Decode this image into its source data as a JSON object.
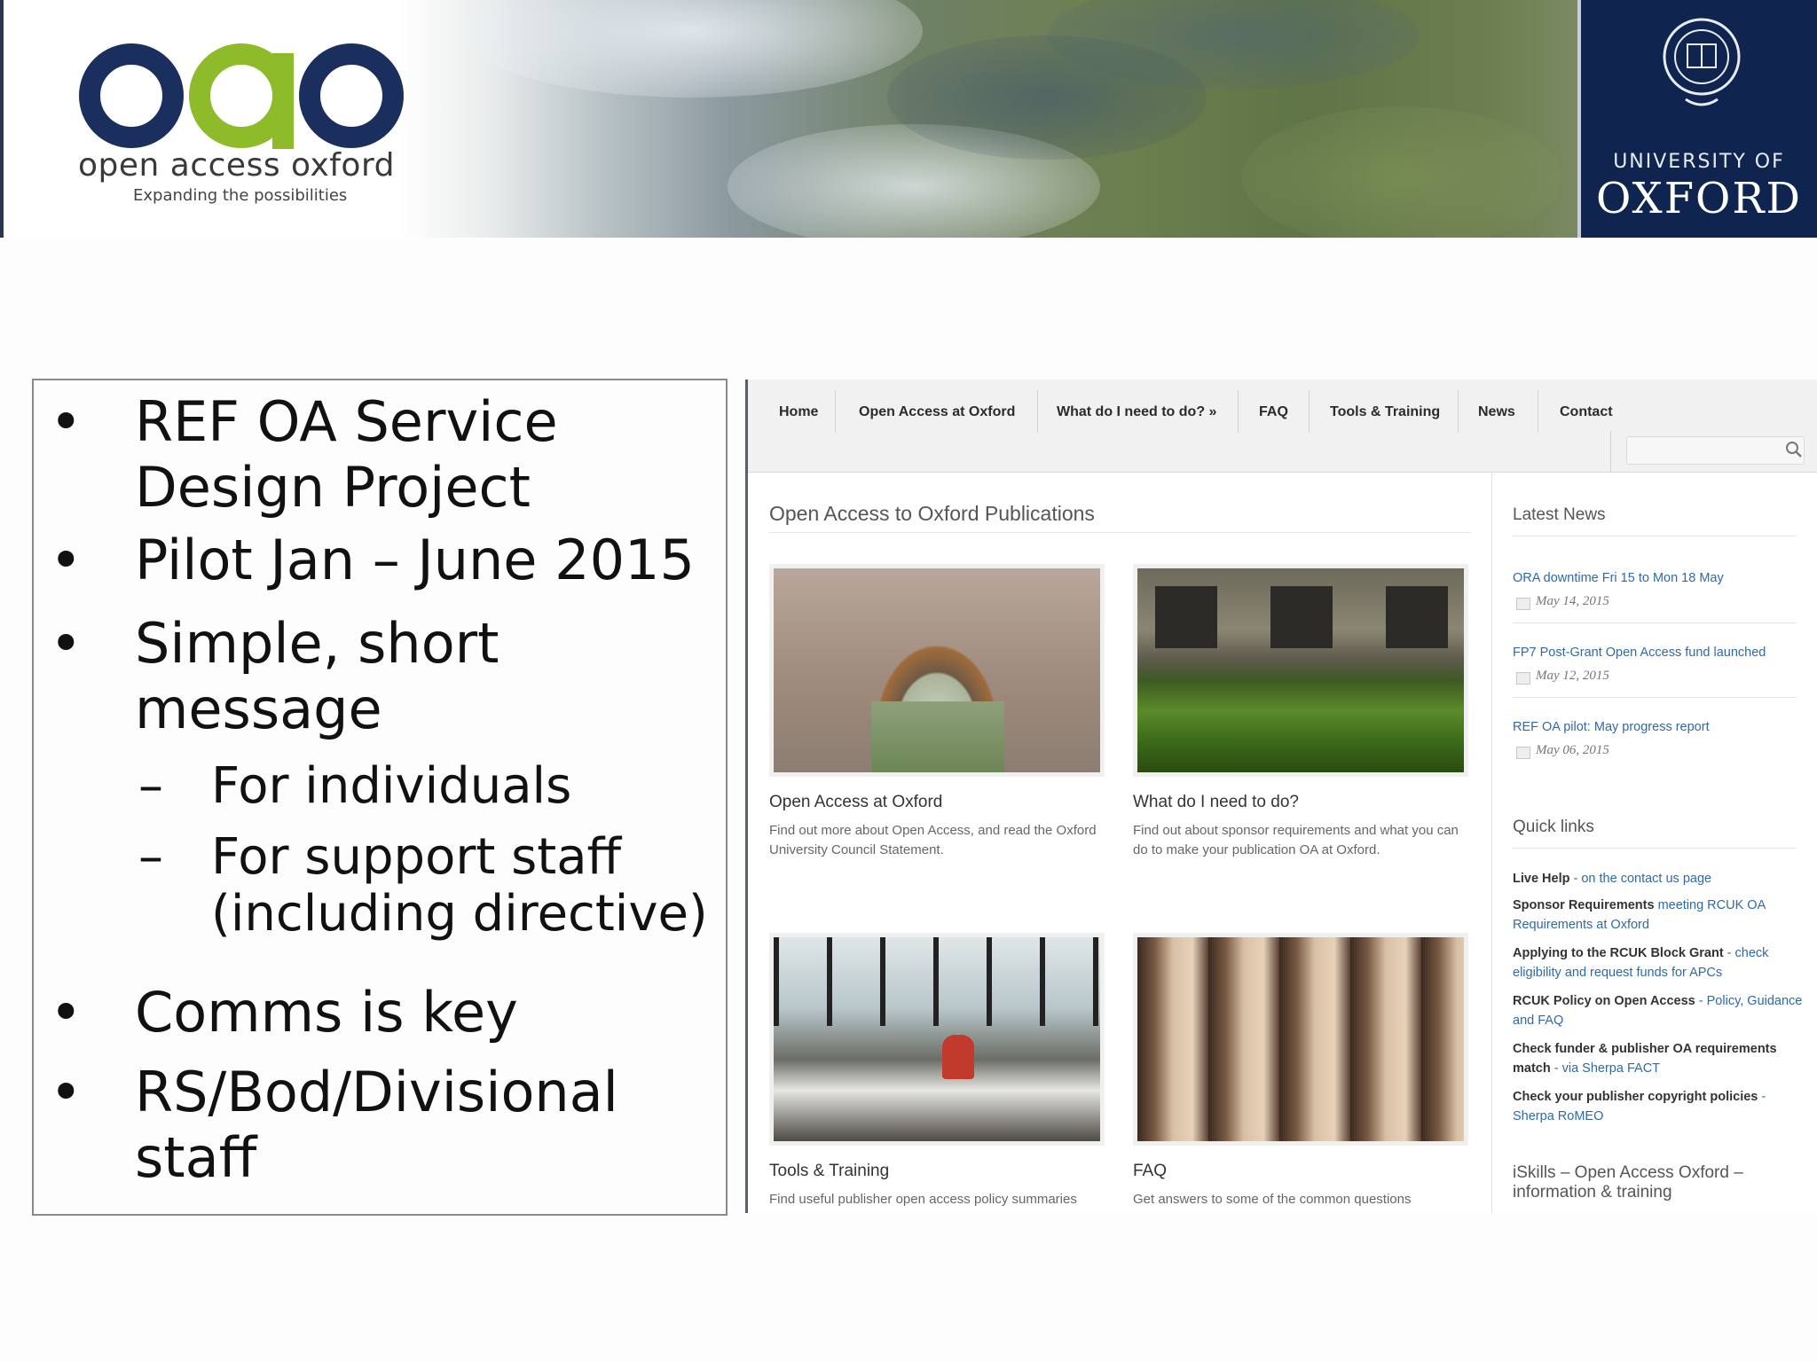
{
  "banner": {
    "logo_name": "open access oxford",
    "logo_tagline": "Expanding the possibilities",
    "university_of": "UNIVERSITY OF",
    "oxford": "OXFORD"
  },
  "bullets": [
    {
      "level": 1,
      "lines": [
        "REF OA Service",
        "Design Project"
      ]
    },
    {
      "level": 1,
      "lines": [
        "Pilot Jan – June 2015"
      ]
    },
    {
      "level": 1,
      "lines": [
        "Simple, short",
        "message"
      ]
    },
    {
      "level": 2,
      "lines": [
        "For individuals"
      ]
    },
    {
      "level": 2,
      "lines": [
        "For support staff",
        "(including directive)"
      ]
    },
    {
      "level": 1,
      "lines": [
        "Comms is key"
      ]
    },
    {
      "level": 1,
      "lines": [
        "RS/Bod/Divisional",
        "staff"
      ]
    }
  ],
  "site": {
    "nav": [
      "Home",
      "Open Access at Oxford",
      "What do I need to do? »",
      "FAQ",
      "Tools & Training",
      "News",
      "Contact"
    ],
    "search_placeholder": "",
    "main_title": "Open Access to Oxford Publications",
    "cards": [
      {
        "title": "Open Access at Oxford",
        "desc": "Find out more about Open Access, and read the Oxford University Council Statement."
      },
      {
        "title": "What do I need to do?",
        "desc": "Find out about sponsor requirements and what you can do to make your publication OA at Oxford."
      },
      {
        "title": "Tools & Training",
        "desc": "Find useful publisher open access policy summaries"
      },
      {
        "title": "FAQ",
        "desc": "Get answers to some of the common questions"
      }
    ],
    "latest_news_title": "Latest News",
    "news": [
      {
        "title": "ORA downtime Fri 15 to Mon 18 May",
        "date": "May 14, 2015"
      },
      {
        "title": "FP7 Post-Grant Open Access fund launched",
        "date": "May 12, 2015"
      },
      {
        "title": "REF OA pilot: May progress report",
        "date": "May 06, 2015"
      }
    ],
    "quick_links_title": "Quick links",
    "quick_links": [
      {
        "bold": "Live Help",
        "sep": " - ",
        "link": "on the contact us page"
      },
      {
        "bold": "Sponsor Requirements",
        "sep": " ",
        "link": "meeting RCUK OA Requirements at Oxford"
      },
      {
        "bold": "Applying to the RCUK Block Grant",
        "sep": " - ",
        "link": "check eligibility and request funds for APCs"
      },
      {
        "bold": "RCUK Policy on Open Access",
        "sep": " - ",
        "link": "Policy, Guidance and FAQ"
      },
      {
        "bold": "Check funder & publisher OA requirements match",
        "sep": " - ",
        "link": "via Sherpa FACT"
      },
      {
        "bold": "Check your publisher copyright policies",
        "sep": " - ",
        "link": "Sherpa RoMEO"
      }
    ],
    "iskills": "iSkills – Open Access Oxford – information & training"
  },
  "colors": {
    "oxford_blue": "#0f2550",
    "logo_navy": "#1b2f5e",
    "logo_green": "#8dbb2a",
    "link_blue": "#2f6aa8"
  }
}
